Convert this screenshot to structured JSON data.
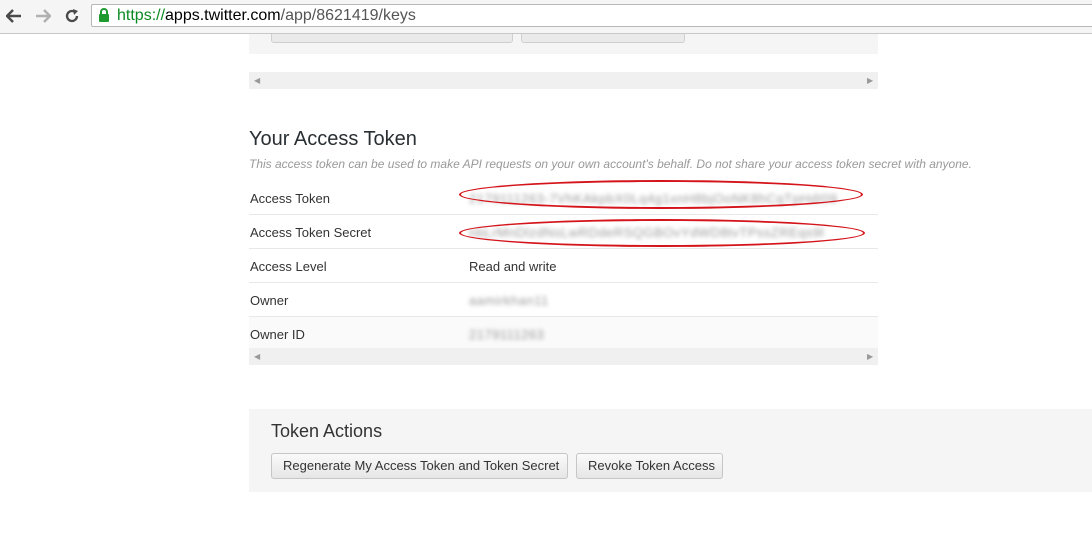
{
  "browser": {
    "url_scheme": "https://",
    "url_host": "apps.twitter.com",
    "url_path": "/app/8621419/keys"
  },
  "access_token_section": {
    "title": "Your Access Token",
    "subtitle": "This access token can be used to make API requests on your own account's behalf. Do not share your access token secret with anyone.",
    "rows": [
      {
        "label": "Access Token",
        "value": "2179111263-7VhKAkpbX0Lq4g1xnH8bjOoNK8hCqTpHdI09"
      },
      {
        "label": "Access Token Secret",
        "value": "nbLrMnDlzdNsLwRDdeRSQGBOvYdWD8tvTPssZREqs9l"
      },
      {
        "label": "Access Level",
        "value": "Read and write"
      },
      {
        "label": "Owner",
        "value": "aamirkhan11"
      },
      {
        "label": "Owner ID",
        "value": "2179111263"
      }
    ]
  },
  "token_actions": {
    "title": "Token Actions",
    "regenerate_label": "Regenerate My Access Token and Token Secret",
    "revoke_label": "Revoke Token Access"
  },
  "annotation_color": "#d4141a"
}
